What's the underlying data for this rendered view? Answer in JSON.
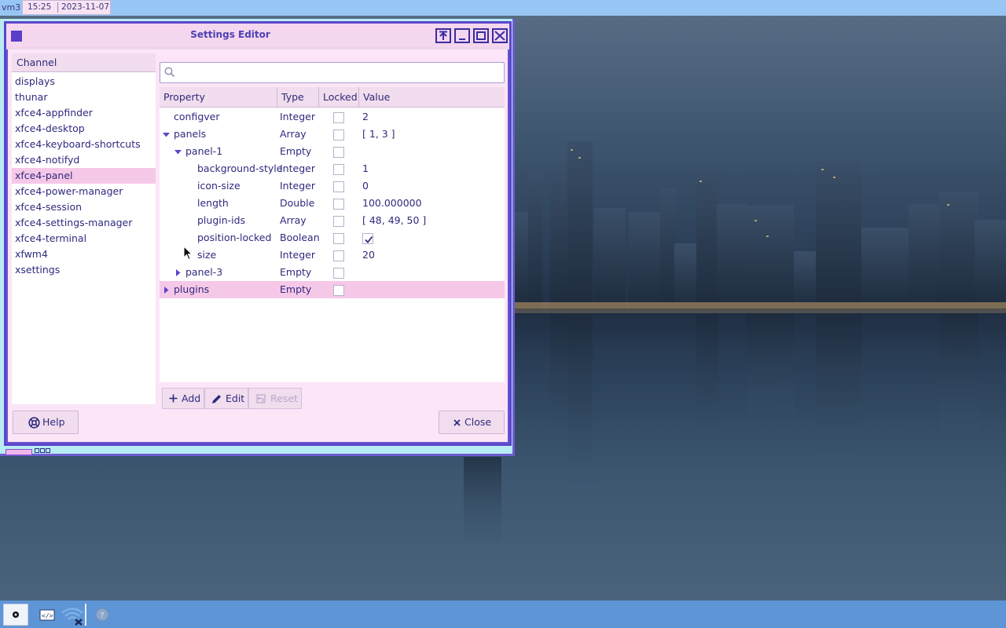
{
  "top_panel": {
    "workspace": "vm3",
    "clock_time": "15:25",
    "clock_date": "2023-11-07"
  },
  "window": {
    "title": "Settings Editor",
    "buttons": [
      "shade",
      "minimize",
      "maximize",
      "close"
    ]
  },
  "channels": {
    "header": "Channel",
    "items": [
      {
        "label": "displays"
      },
      {
        "label": "thunar"
      },
      {
        "label": "xfce4-appfinder"
      },
      {
        "label": "xfce4-desktop"
      },
      {
        "label": "xfce4-keyboard-shortcuts"
      },
      {
        "label": "xfce4-notifyd"
      },
      {
        "label": "xfce4-panel",
        "selected": true
      },
      {
        "label": "xfce4-power-manager"
      },
      {
        "label": "xfce4-session"
      },
      {
        "label": "xfce4-settings-manager"
      },
      {
        "label": "xfce4-terminal"
      },
      {
        "label": "xfwm4"
      },
      {
        "label": "xsettings"
      }
    ]
  },
  "search": {
    "placeholder": "",
    "value": ""
  },
  "tree": {
    "columns": [
      "Property",
      "Type",
      "Locked",
      "Value"
    ],
    "rows": [
      {
        "name": "configver",
        "depth": 0,
        "expander": "none",
        "type": "Integer",
        "locked": false,
        "value": "2"
      },
      {
        "name": "panels",
        "depth": 0,
        "expander": "expanded",
        "type": "Array",
        "locked": false,
        "value": "[ 1, 3 ]"
      },
      {
        "name": "panel-1",
        "depth": 1,
        "expander": "expanded",
        "type": "Empty",
        "locked": false,
        "value": ""
      },
      {
        "name": "background-style",
        "depth": 2,
        "expander": "none",
        "type": "Integer",
        "locked": false,
        "value": "1"
      },
      {
        "name": "icon-size",
        "depth": 2,
        "expander": "none",
        "type": "Integer",
        "locked": false,
        "value": "0"
      },
      {
        "name": "length",
        "depth": 2,
        "expander": "none",
        "type": "Double",
        "locked": false,
        "value": "100.000000"
      },
      {
        "name": "plugin-ids",
        "depth": 2,
        "expander": "none",
        "type": "Array",
        "locked": false,
        "value": "[ 48, 49, 50 ]"
      },
      {
        "name": "position-locked",
        "depth": 2,
        "expander": "none",
        "type": "Boolean",
        "locked": false,
        "value": "",
        "bool_value": true
      },
      {
        "name": "size",
        "depth": 2,
        "expander": "none",
        "type": "Integer",
        "locked": false,
        "value": "20"
      },
      {
        "name": "panel-3",
        "depth": 1,
        "expander": "collapsed",
        "type": "Empty",
        "locked": false,
        "value": ""
      },
      {
        "name": "plugins",
        "depth": 0,
        "expander": "collapsed",
        "type": "Empty",
        "locked": false,
        "value": "",
        "selected": true
      }
    ]
  },
  "actions": {
    "add": "Add",
    "edit": "Edit",
    "reset": "Reset"
  },
  "footer": {
    "help": "Help",
    "close": "Close"
  },
  "bottom_panel": {
    "items": [
      "show-desktop-icon",
      "terminal-icon",
      "network-disconnected-icon",
      "help-icon"
    ]
  },
  "colors": {
    "accent": "#5b46cc",
    "selection": "#f6c8e8",
    "panel_blue": "#98c6f4",
    "taskbar_blue": "#5e95d6",
    "text": "#2e2a7e"
  }
}
